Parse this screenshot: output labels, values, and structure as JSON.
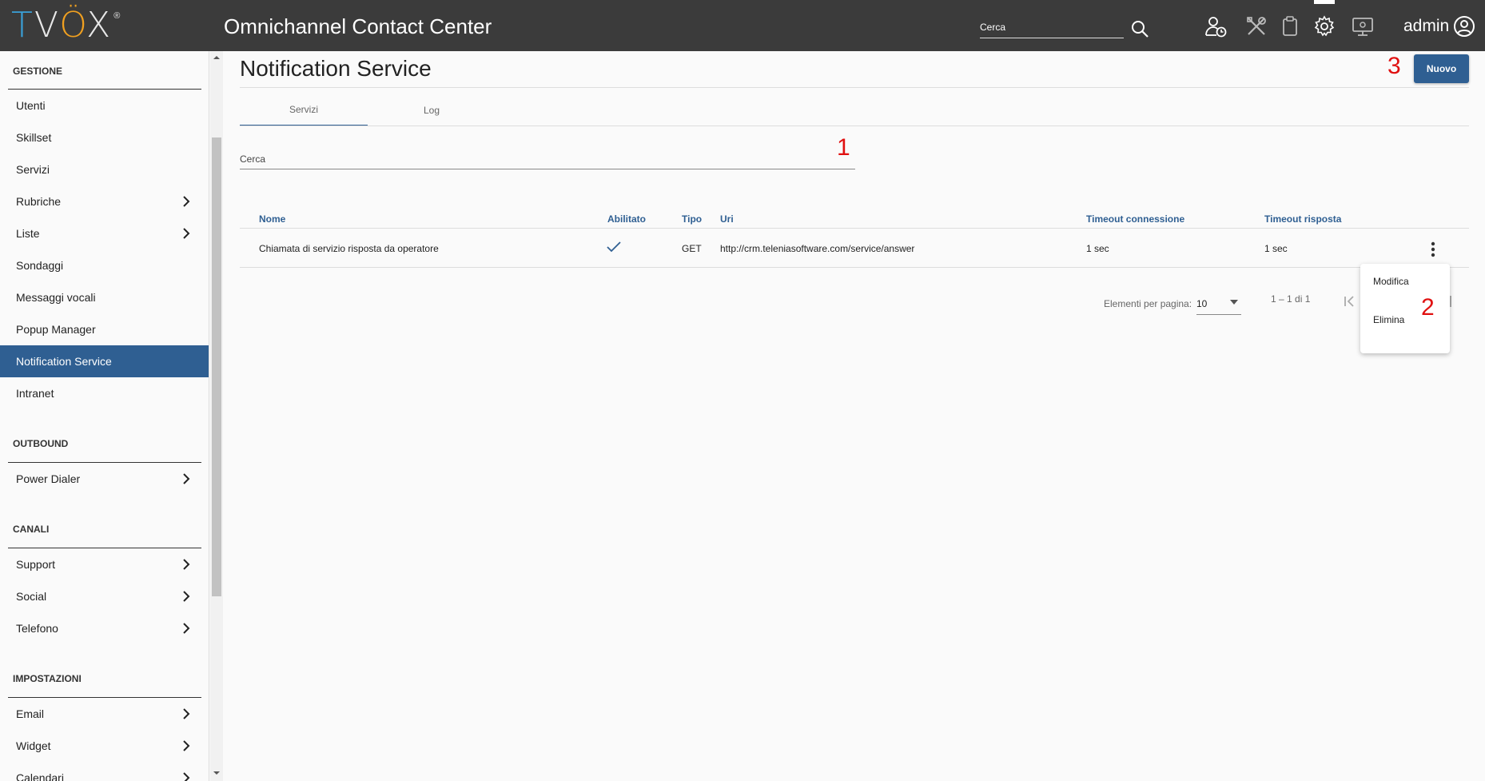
{
  "header": {
    "logo": "TVOX",
    "logo_mark": "®",
    "app_title": "Omnichannel Contact Center",
    "search_placeholder": "Cerca",
    "user": "admin",
    "icons": [
      "agent-status-icon",
      "tools-icon",
      "clipboard-icon",
      "gear-icon",
      "monitor-icon",
      "account-circle-icon"
    ]
  },
  "sidebar": {
    "sections": [
      {
        "title": "GESTIONE",
        "items": [
          {
            "label": "Utenti",
            "chevron": false
          },
          {
            "label": "Skillset",
            "chevron": false
          },
          {
            "label": "Servizi",
            "chevron": false
          },
          {
            "label": "Rubriche",
            "chevron": true
          },
          {
            "label": "Liste",
            "chevron": true
          },
          {
            "label": "Sondaggi",
            "chevron": false
          },
          {
            "label": "Messaggi vocali",
            "chevron": false
          },
          {
            "label": "Popup Manager",
            "chevron": false
          },
          {
            "label": "Notification Service",
            "chevron": false,
            "active": true
          },
          {
            "label": "Intranet",
            "chevron": false
          }
        ]
      },
      {
        "title": "OUTBOUND",
        "items": [
          {
            "label": "Power Dialer",
            "chevron": true
          }
        ]
      },
      {
        "title": "CANALI",
        "items": [
          {
            "label": "Support",
            "chevron": true
          },
          {
            "label": "Social",
            "chevron": true
          },
          {
            "label": "Telefono",
            "chevron": true
          }
        ]
      },
      {
        "title": "IMPOSTAZIONI",
        "items": [
          {
            "label": "Email",
            "chevron": true
          },
          {
            "label": "Widget",
            "chevron": true
          },
          {
            "label": "Calendari",
            "chevron": true
          }
        ]
      }
    ]
  },
  "main": {
    "page_title": "Notification Service",
    "new_button": "Nuovo",
    "tabs": [
      {
        "label": "Servizi",
        "active": true
      },
      {
        "label": "Log",
        "active": false
      }
    ],
    "search_placeholder": "Cerca",
    "annotations": {
      "a1": "1",
      "a2": "2",
      "a3": "3"
    },
    "table": {
      "columns": [
        "Nome",
        "Abilitato",
        "Tipo",
        "Uri",
        "Timeout connessione",
        "Timeout risposta"
      ],
      "rows": [
        {
          "nome": "Chiamata di servizio risposta da operatore",
          "abilitato": true,
          "tipo": "GET",
          "uri": "http://crm.teleniasoftware.com/service/answer",
          "timeout_connessione": "1 sec",
          "timeout_risposta": "1 sec"
        }
      ]
    },
    "paginator": {
      "label": "Elementi per pagina:",
      "page_size": "10",
      "range": "1 – 1 di 1"
    },
    "row_menu": {
      "items": [
        "Modifica",
        "Elimina"
      ]
    }
  },
  "colors": {
    "header_bg": "#3b3b3b",
    "accent": "#2f5f92",
    "annotation": "#e01010"
  }
}
